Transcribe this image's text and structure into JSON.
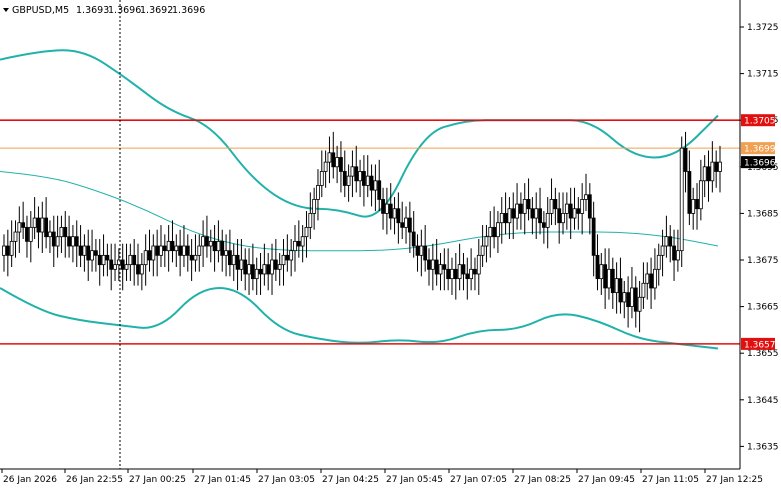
{
  "header": {
    "symbol": "GBPUSD,M5",
    "open": "1.3693",
    "high": "1.3696",
    "low": "1.3692",
    "close": "1.3696"
  },
  "colors": {
    "background": "#ffffff",
    "grid": "#c8c8c8",
    "candle": "#000000",
    "bands": "#20b2aa",
    "level_line": "#e01010",
    "level_label_bg": "#e01010",
    "current_line": "#f0a050",
    "current_label_bg": "#f0a050",
    "last_price_label_bg": "#000000"
  },
  "chart_data": {
    "type": "candlestick",
    "price_axis": {
      "min": 1.3628,
      "max": 1.3729,
      "ticks": [
        "1.3725",
        "1.3715",
        "1.3705",
        "1.3695",
        "1.3685",
        "1.3675",
        "1.3665",
        "1.3655",
        "1.3645",
        "1.3635"
      ],
      "position": "right"
    },
    "time_axis": {
      "ticks": [
        "26 Jan 2026",
        "26 Jan 22:55",
        "27 Jan 00:25",
        "27 Jan 01:45",
        "27 Jan 03:05",
        "27 Jan 04:25",
        "27 Jan 05:45",
        "27 Jan 07:05",
        "27 Jan 08:25",
        "27 Jan 09:45",
        "27 Jan 11:05",
        "27 Jan 12:25"
      ]
    },
    "levels": [
      {
        "name": "resistance",
        "price": 1.3705,
        "label": "1.3705",
        "color": "#e01010"
      },
      {
        "name": "pivot",
        "price": 1.3699,
        "label": "1.3699",
        "color": "#f0a050"
      },
      {
        "name": "support",
        "price": 1.3657,
        "label": "1.3657",
        "color": "#e01010"
      }
    ],
    "last_price": {
      "price": 1.3696,
      "label": "1.3696"
    },
    "vertical_marker": {
      "time": "26 Jan 22:55",
      "style": "dotted"
    },
    "grid": false,
    "candle_closes": [
      1.3678,
      1.3676,
      1.3679,
      1.3681,
      1.3683,
      1.3682,
      1.3679,
      1.3682,
      1.3684,
      1.3681,
      1.3684,
      1.368,
      1.3681,
      1.3678,
      1.368,
      1.3682,
      1.368,
      1.3678,
      1.368,
      1.3678,
      1.3676,
      1.3678,
      1.3675,
      1.3677,
      1.3676,
      1.3674,
      1.3676,
      1.3675,
      1.3673,
      1.3674,
      1.3675,
      1.3673,
      1.3674,
      1.3676,
      1.3674,
      1.3672,
      1.3674,
      1.3677,
      1.3675,
      1.3678,
      1.3676,
      1.3678,
      1.3677,
      1.3679,
      1.3677,
      1.3678,
      1.3676,
      1.3678,
      1.3676,
      1.3675,
      1.3676,
      1.3678,
      1.368,
      1.3678,
      1.3679,
      1.3677,
      1.3679,
      1.3676,
      1.3677,
      1.3674,
      1.3676,
      1.3673,
      1.3675,
      1.3672,
      1.3674,
      1.3671,
      1.3673,
      1.3672,
      1.3674,
      1.3672,
      1.3675,
      1.3673,
      1.3674,
      1.3676,
      1.3675,
      1.3677,
      1.3679,
      1.3678,
      1.368,
      1.3682,
      1.3685,
      1.3688,
      1.3691,
      1.3694,
      1.3696,
      1.3698,
      1.3695,
      1.3697,
      1.3694,
      1.3691,
      1.3693,
      1.3695,
      1.3692,
      1.3694,
      1.3691,
      1.3693,
      1.369,
      1.3692,
      1.3688,
      1.3685,
      1.3687,
      1.3684,
      1.3686,
      1.3683,
      1.3682,
      1.3684,
      1.3681,
      1.3678,
      1.3676,
      1.3678,
      1.3675,
      1.3673,
      1.3675,
      1.3672,
      1.3674,
      1.3673,
      1.3671,
      1.3673,
      1.3671,
      1.3674,
      1.3672,
      1.3671,
      1.3673,
      1.3672,
      1.3676,
      1.3678,
      1.368,
      1.3682,
      1.368,
      1.3683,
      1.3685,
      1.3683,
      1.3686,
      1.3684,
      1.3687,
      1.3685,
      1.3688,
      1.3686,
      1.3684,
      1.3686,
      1.3683,
      1.3682,
      1.3685,
      1.3688,
      1.3686,
      1.3683,
      1.3685,
      1.3687,
      1.3684,
      1.3686,
      1.3685,
      1.3688,
      1.3689,
      1.3684,
      1.3676,
      1.3671,
      1.3674,
      1.3669,
      1.3673,
      1.3668,
      1.3671,
      1.3666,
      1.3668,
      1.3665,
      1.3669,
      1.3664,
      1.3667,
      1.367,
      1.3672,
      1.3669,
      1.3673,
      1.3676,
      1.3678,
      1.368,
      1.3678,
      1.3675,
      1.3677,
      1.3699,
      1.3694,
      1.3685,
      1.3688,
      1.3686,
      1.3692,
      1.3695,
      1.3692,
      1.3696,
      1.3694,
      1.3696
    ],
    "band_mid": [
      1.3694,
      1.3693,
      1.369,
      1.3686,
      1.3681,
      1.3678,
      1.3677,
      1.3677,
      1.3677,
      1.3678,
      1.368,
      1.3681,
      1.3681,
      1.3681,
      1.368,
      1.3678
    ],
    "band_upper": [
      1.3718,
      1.372,
      1.372,
      1.3714,
      1.3707,
      1.3704,
      1.3692,
      1.3686,
      1.3686,
      1.3683,
      1.3702,
      1.3705,
      1.3705,
      1.3705,
      1.3705,
      1.3697,
      1.3697,
      1.3706
    ],
    "band_lower": [
      1.3669,
      1.3664,
      1.3662,
      1.3661,
      1.366,
      1.3669,
      1.3669,
      1.366,
      1.3658,
      1.3657,
      1.3658,
      1.3657,
      1.366,
      1.366,
      1.3664,
      1.3662,
      1.3658,
      1.3657,
      1.3656
    ]
  }
}
